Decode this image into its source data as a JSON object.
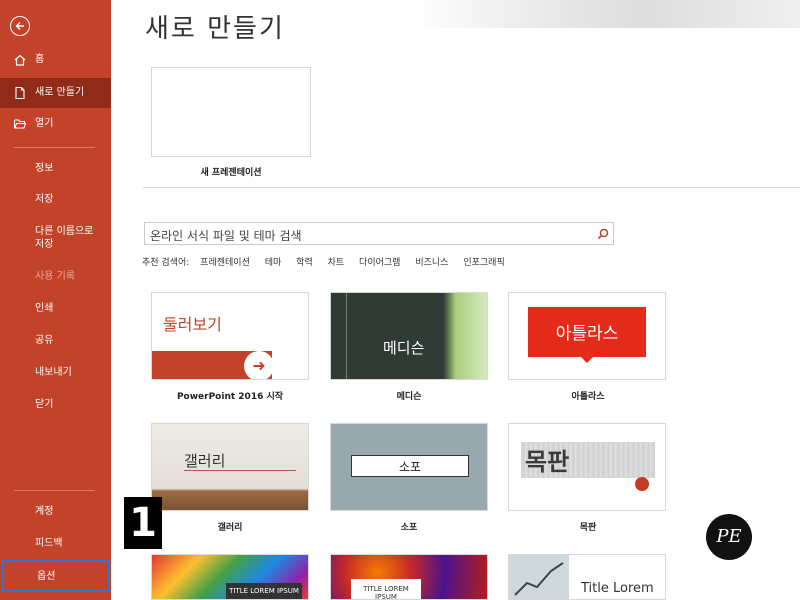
{
  "sidebar": {
    "back_icon": "back-arrow-icon",
    "home": "홈",
    "new": "새로 만들기",
    "open": "열기",
    "info": "정보",
    "save": "저장",
    "save_as_line1": "다른 이름으로",
    "save_as_line2": "저장",
    "history": "사용 기록",
    "print": "인쇄",
    "share": "공유",
    "export": "내보내기",
    "close": "닫기",
    "account": "계정",
    "feedback": "피드백",
    "options": "옵션"
  },
  "main": {
    "title": "새로 만들기",
    "blank_caption": "새 프레젠테이션",
    "search_placeholder": "온라인 서식 파일 및 테마 검색",
    "suggest_label": "추천 검색어:",
    "suggestions": [
      "프레젠테이션",
      "테마",
      "학력",
      "차트",
      "다이어그램",
      "비즈니스",
      "인포그래픽"
    ],
    "templates": [
      {
        "caption": "PowerPoint 2016 시작",
        "thumb_text": "둘러보기"
      },
      {
        "caption": "메디슨",
        "thumb_text": "메디슨"
      },
      {
        "caption": "아틀라스",
        "thumb_text": "아틀라스"
      },
      {
        "caption": "갤러리",
        "thumb_text": "갤러리"
      },
      {
        "caption": "소포",
        "thumb_text": "소포"
      },
      {
        "caption": "목판",
        "thumb_text": "목판"
      },
      {
        "caption": "",
        "thumb_text": "TITLE LOREM IPSUM"
      },
      {
        "caption": "",
        "thumb_text": "TITLE LOREM IPSUM"
      },
      {
        "caption": "",
        "thumb_text": "Title Lorem"
      }
    ]
  },
  "overlay": {
    "step_badge": "1",
    "logo_text": "PE"
  },
  "colors": {
    "sidebar_bg": "#c3432a",
    "sidebar_active": "#8f2b18",
    "accent_red": "#c3432a",
    "options_highlight": "#2b78d4"
  }
}
